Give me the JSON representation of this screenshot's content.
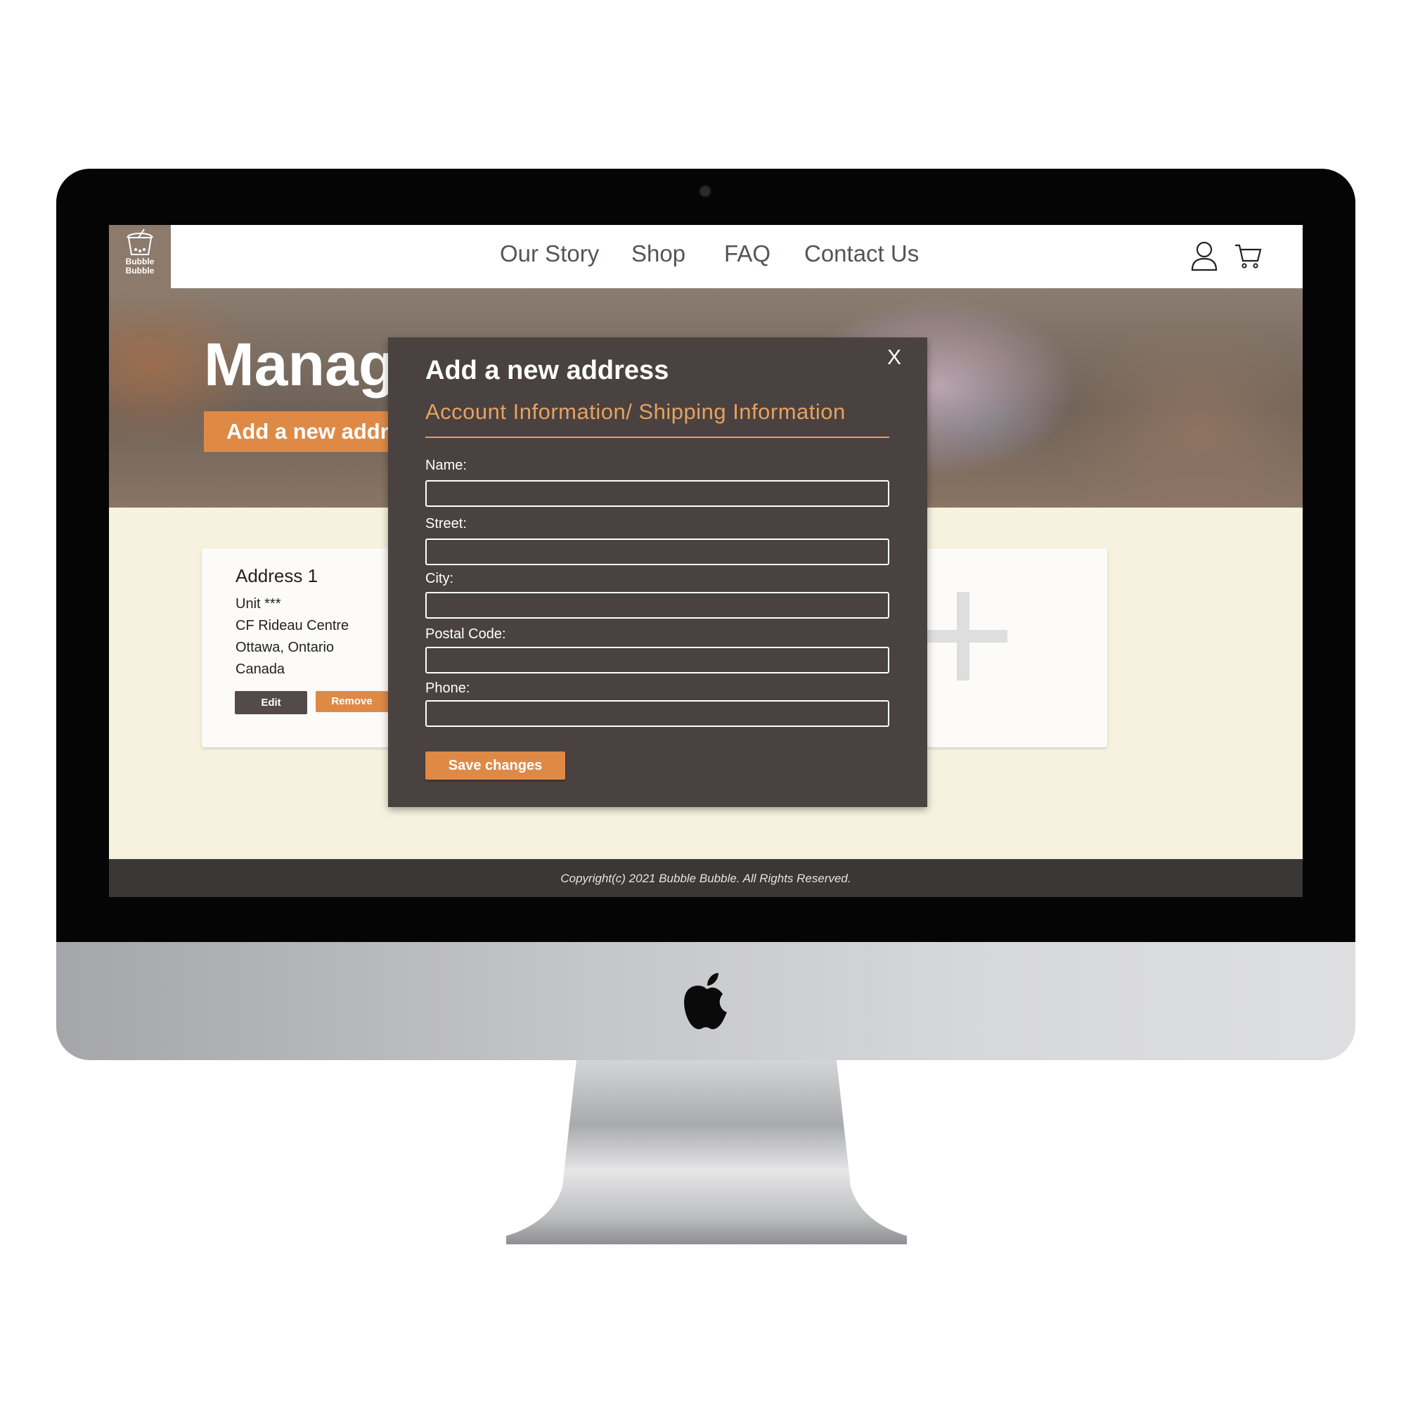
{
  "nav": {
    "logo_line1": "Bubble",
    "logo_line2": "Bubble",
    "links": [
      "Our Story",
      "Shop",
      "FAQ",
      "Contact Us"
    ],
    "icons": [
      "user-icon",
      "cart-icon"
    ]
  },
  "hero": {
    "title": "Manag",
    "button": "Add a new addr"
  },
  "address_card": {
    "title": "Address 1",
    "lines": [
      "Unit ***",
      "CF Rideau Centre",
      "Ottawa, Ontario",
      "Canada"
    ],
    "edit": "Edit",
    "remove": "Remove"
  },
  "add_card": {
    "icon": "plus-icon"
  },
  "modal": {
    "close": "X",
    "title": "Add a new address",
    "subtitle": "Account Information/ Shipping Information",
    "fields": [
      {
        "label": "Name:",
        "value": ""
      },
      {
        "label": "Street:",
        "value": ""
      },
      {
        "label": "City:",
        "value": ""
      },
      {
        "label": "Postal Code:",
        "value": ""
      },
      {
        "label": "Phone:",
        "value": ""
      }
    ],
    "save": "Save changes"
  },
  "footer": {
    "text": "Copyright(c) 2021 Bubble Bubble. All Rights Reserved."
  },
  "colors": {
    "accent": "#de8a46",
    "modal_bg": "#4a4240",
    "page_bg": "#f7f1df",
    "footer_bg": "#3a3737"
  }
}
